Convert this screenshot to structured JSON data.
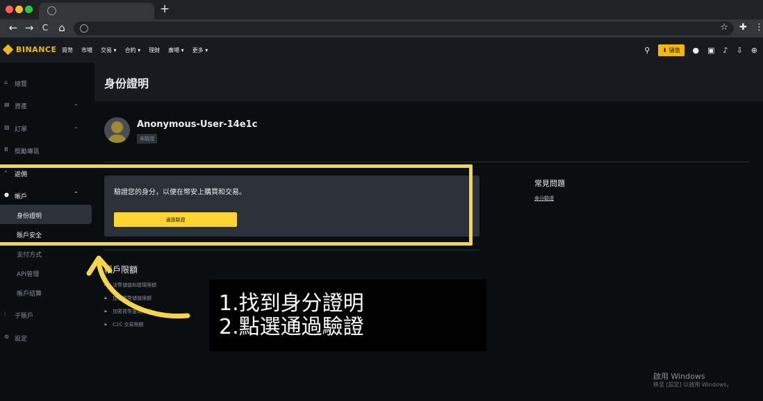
{
  "browser": {
    "new_tab_glyph": "+",
    "nav_back": "←",
    "nav_forward": "→",
    "nav_reload": "C",
    "nav_home": "⌂"
  },
  "header": {
    "logo_text": "BINANCE",
    "nav": [
      "買幣",
      "市場",
      "交易 ▾",
      "合約 ▾",
      "理財",
      "廣場 ▾",
      "更多 ▾"
    ],
    "deposit_label": "⬇ 儲值"
  },
  "sidebar": {
    "items": [
      {
        "icon": "home-icon",
        "label": "總覽"
      },
      {
        "icon": "wallet-icon",
        "label": "資產"
      },
      {
        "icon": "orders-icon",
        "label": "訂單"
      },
      {
        "icon": "reward-icon",
        "label": "獎勵專區"
      },
      {
        "icon": "referral-icon",
        "label": "返佣"
      },
      {
        "icon": "account-icon",
        "label": "帳戶"
      },
      {
        "icon": "subaccount-icon",
        "label": "子賬戶"
      },
      {
        "icon": "settings-icon",
        "label": "設定"
      }
    ],
    "account_sub": [
      "身份證明",
      "賬戶安全",
      "支付方式",
      "API管理",
      "帳戶結算"
    ]
  },
  "main": {
    "page_title": "身份證明",
    "username": "Anonymous-User-14e1c",
    "status_badge": "未驗證",
    "card_text": "驗證您的身分，以便在幣安上購買和交易。",
    "verify_button": "通過驗證",
    "limits_title": "帳戶限額",
    "limits": [
      "法幣儲值和提現限額",
      "加密貨幣儲值限額",
      "加密貨幣提現限額",
      "C2C 交易限額"
    ],
    "faq_title": "常見問題",
    "faq_link": "身分驗證"
  },
  "annotation": {
    "line1": "1.找到身分證明",
    "line2": "2.點選通過驗證",
    "highlight_color": "#f6d54a"
  },
  "windows_watermark": {
    "line1": "啟用 Windows",
    "line2": "移至 [設定] 以啟用 Windows。"
  }
}
